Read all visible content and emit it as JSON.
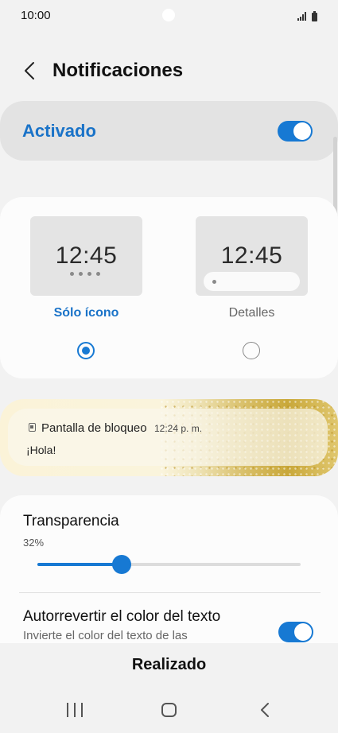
{
  "status_bar": {
    "time": "10:00",
    "icons": [
      "signal-icon",
      "battery-icon"
    ]
  },
  "header": {
    "title": "Notificaciones",
    "back_icon": "chevron-left-icon"
  },
  "master": {
    "label": "Activado",
    "enabled": true
  },
  "notification_style": {
    "options": [
      {
        "preview_time": "12:45",
        "label": "Sólo ícono",
        "selected": true
      },
      {
        "preview_time": "12:45",
        "label": "Detalles",
        "selected": false
      }
    ]
  },
  "lock_preview": {
    "app_name": "Pantalla de bloqueo",
    "time": "12:24 p. m.",
    "message": "¡Hola!"
  },
  "transparency": {
    "label": "Transparencia",
    "value_text": "32%",
    "value": 32
  },
  "auto_reverse": {
    "label": "Autorrevertir el color del texto",
    "subtitle": "Invierte el color del texto de las",
    "enabled": true
  },
  "done_button": {
    "label": "Realizado"
  },
  "nav_bar": {
    "icons": [
      "recents-icon",
      "home-icon",
      "back-icon"
    ]
  },
  "colors": {
    "accent": "#1779d3",
    "accent_text": "#1a73c8",
    "background": "#f2f2f2"
  }
}
